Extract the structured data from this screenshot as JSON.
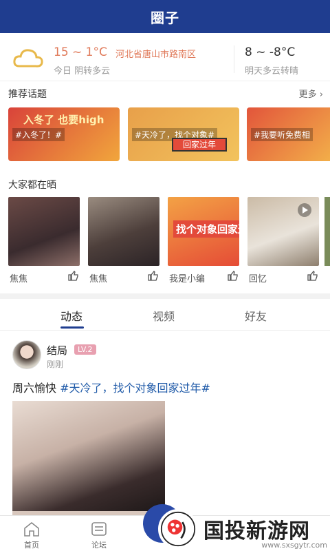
{
  "header": {
    "title": "圈子"
  },
  "weather": {
    "today_temp": "15 ~ 1°C",
    "location": "河北省唐山市路南区",
    "today_desc": "今日 阴转多云",
    "tomorrow_temp": "8 ~ -8°C",
    "tomorrow_desc": "明天多云转晴",
    "icon": "cloud-icon"
  },
  "topics": {
    "title": "推荐话题",
    "more": "更多 ›",
    "items": [
      {
        "tag": "#入冬了！#",
        "banner": "入冬了 也要high"
      },
      {
        "tag": "#天冷了，找个对象#",
        "banner": "回家过年"
      },
      {
        "tag": "#我要听免费相"
      }
    ]
  },
  "sharing": {
    "title": "大家都在晒",
    "items": [
      {
        "label": "焦焦"
      },
      {
        "label": "焦焦"
      },
      {
        "label": "我是小编",
        "img_text": "找个对象回家过"
      },
      {
        "label": "回忆"
      }
    ]
  },
  "tabs": {
    "items": [
      "动态",
      "视频",
      "好友"
    ],
    "active": "动态"
  },
  "post": {
    "user": "结局",
    "level": "LV.2",
    "time": "刚刚",
    "text_plain": "周六愉快 ",
    "text_hash": "#天冷了，找个对象回家过年#"
  },
  "bottom_nav": {
    "items": [
      {
        "label": "首页",
        "icon": "home-icon"
      },
      {
        "label": "论坛",
        "icon": "forum-icon"
      }
    ]
  },
  "watermark": {
    "text": "国投新游网",
    "url": "www.sxsgytr.com"
  },
  "colors": {
    "primary": "#1f3d8f",
    "accent": "#e07a5a",
    "link": "#1f5aa8"
  }
}
